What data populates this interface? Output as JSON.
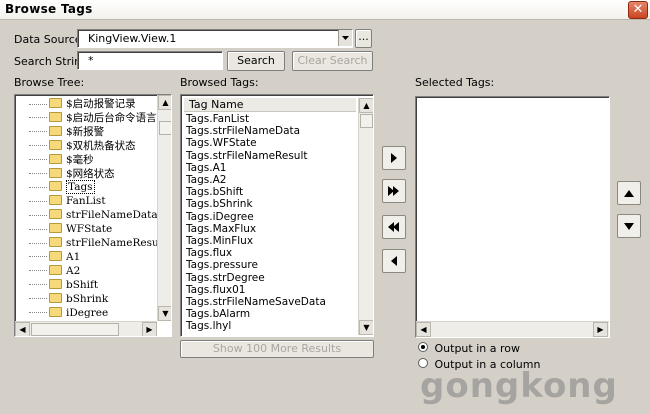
{
  "window": {
    "title": "Browse Tags",
    "close_glyph": "✕"
  },
  "data_source": {
    "label": "Data Source:",
    "value": "KingView.View.1",
    "browse_label": "..."
  },
  "search": {
    "label": "Search String:",
    "value": "*",
    "search_label": "Search",
    "clear_label": "Clear Search"
  },
  "browse_tree": {
    "label": "Browse Tree:",
    "items": [
      "$启动报警记录",
      "$启动后台命令语言",
      "$新报警",
      "$双机热备状态",
      "$毫秒",
      "$网络状态",
      "Tags",
      "FanList",
      "strFileNameData",
      "WFState",
      "strFileNameResult",
      "A1",
      "A2",
      "bShift",
      "bShrink",
      "iDegree"
    ],
    "selected_index": 6
  },
  "browsed_tags": {
    "label": "Browsed Tags:",
    "column_header": "Tag Name",
    "items": [
      "Tags.FanList",
      "Tags.strFileNameData",
      "Tags.WFState",
      "Tags.strFileNameResult",
      "Tags.A1",
      "Tags.A2",
      "Tags.bShift",
      "Tags.bShrink",
      "Tags.iDegree",
      "Tags.MaxFlux",
      "Tags.MinFlux",
      "Tags.flux",
      "Tags.pressure",
      "Tags.strDegree",
      "Tags.flux01",
      "Tags.strFileNameSaveData",
      "Tags.bAlarm",
      "Tags.lhyl"
    ],
    "show_more_label": "Show 100 More Results"
  },
  "transfer_buttons": [
    "add-icon",
    "add-all-icon",
    "remove-all-icon",
    "remove-icon"
  ],
  "selected_tags": {
    "label": "Selected Tags:"
  },
  "output": {
    "row_label": "Output in a row",
    "column_label": "Output in a column",
    "selected": "row"
  },
  "watermark": "gongkong"
}
